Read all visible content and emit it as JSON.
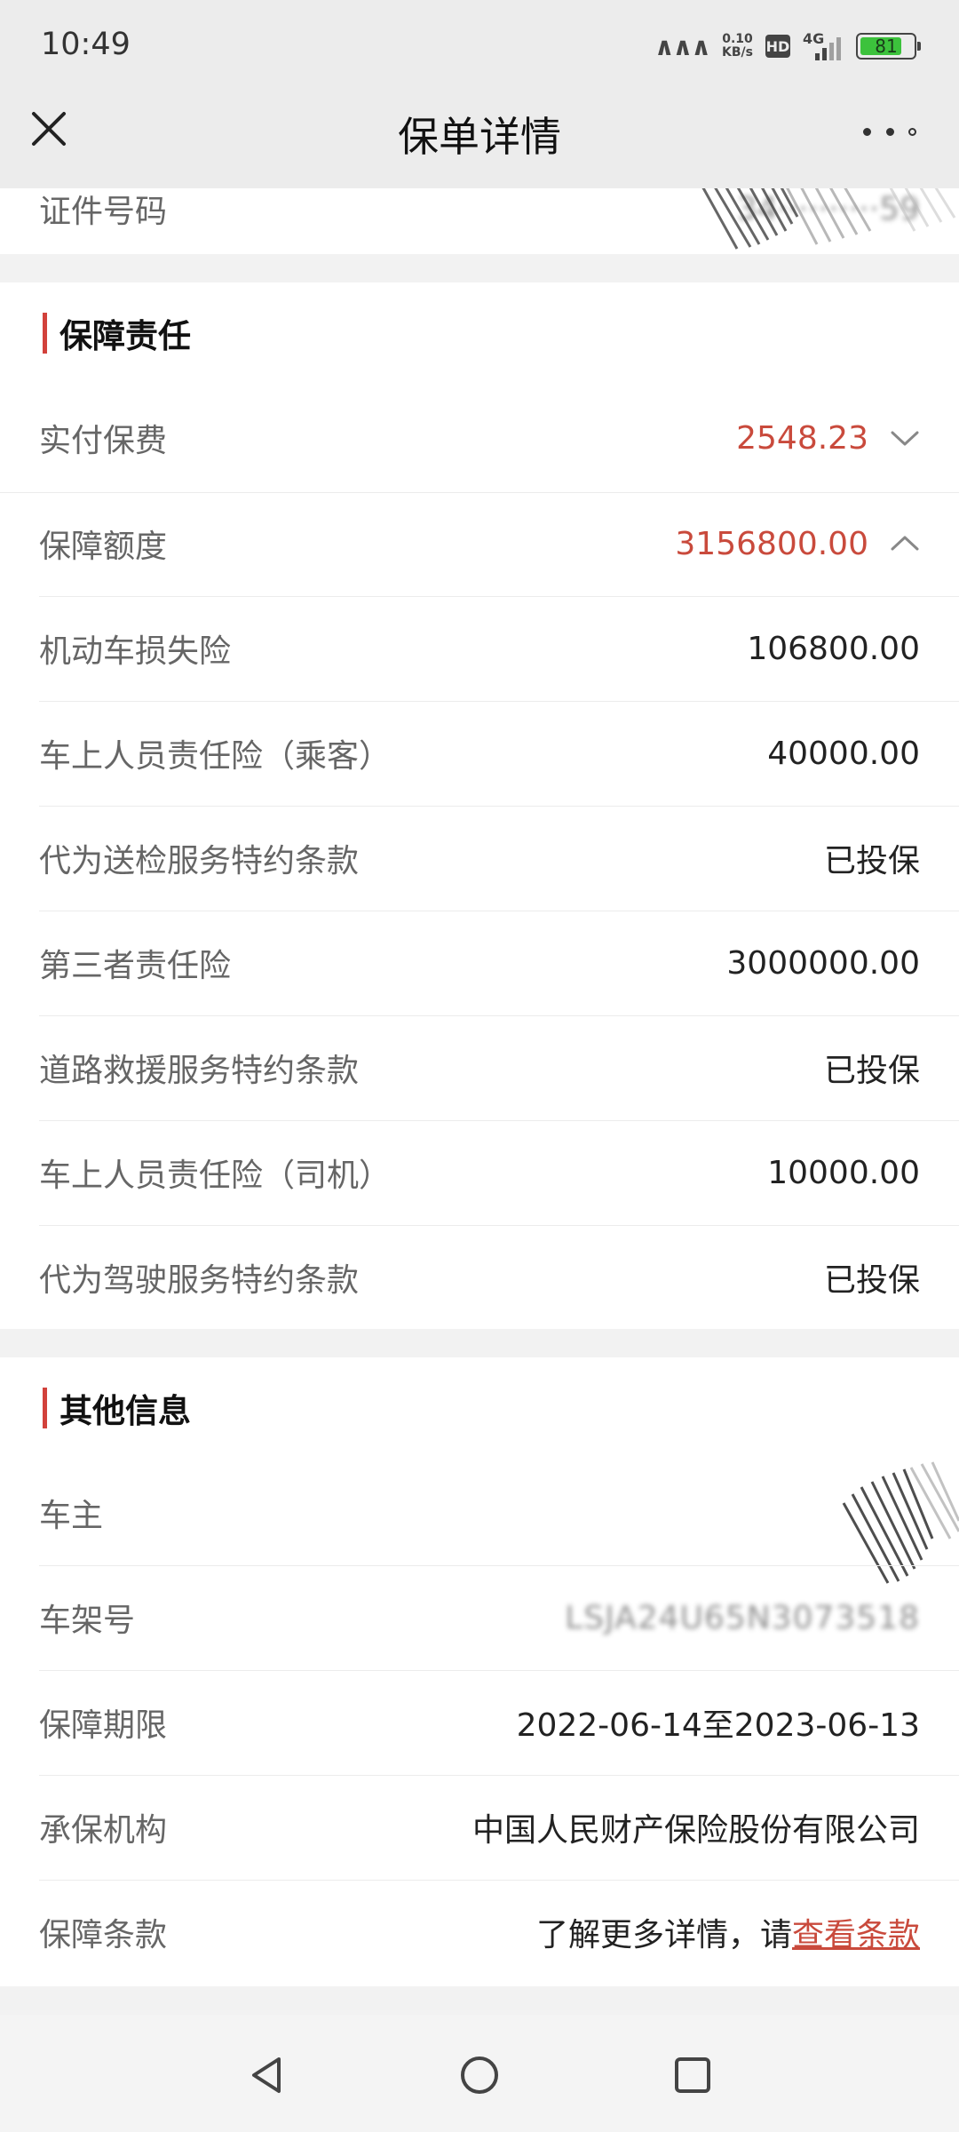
{
  "status_bar": {
    "time": "10:49",
    "net_speed_value": "0.10",
    "net_speed_unit": "KB/s",
    "hd_label": "HD",
    "network_type": "4G",
    "battery_level": "81",
    "battery_fill_fraction": 0.81
  },
  "header": {
    "title": "保单详情",
    "close_icon": "close-icon",
    "more_icon": "more-dots-icon"
  },
  "top_card": {
    "id_label": "证件号码",
    "id_value": "34··········59"
  },
  "coverage": {
    "title": "保障责任",
    "premium_label": "实付保费",
    "premium_value": "2548.23",
    "coverage_label": "保障额度",
    "coverage_value": "3156800.00",
    "items": [
      {
        "label": "机动车损失险",
        "value": "106800.00"
      },
      {
        "label": "车上人员责任险（乘客）",
        "value": "40000.00"
      },
      {
        "label": "代为送检服务特约条款",
        "value": "已投保"
      },
      {
        "label": "第三者责任险",
        "value": "3000000.00"
      },
      {
        "label": "道路救援服务特约条款",
        "value": "已投保"
      },
      {
        "label": "车上人员责任险（司机）",
        "value": "10000.00"
      },
      {
        "label": "代为驾驶服务特约条款",
        "value": "已投保"
      }
    ]
  },
  "other_info": {
    "title": "其他信息",
    "owner_label": "车主",
    "vin_label": "车架号",
    "vin_value": "LSJA24U65N3073518",
    "period_label": "保障期限",
    "period_value": "2022-06-14至2023-06-13",
    "insurer_label": "承保机构",
    "insurer_value": "中国人民财产保险股份有限公司",
    "terms_label": "保障条款",
    "terms_prefix": "了解更多详情，请",
    "terms_link": "查看条款"
  },
  "colors": {
    "accent_red": "#c94a3c",
    "section_bar": "#d2413b",
    "battery_green": "#3cc23c",
    "background": "#f2f2f2"
  },
  "nav_bar": {
    "back_icon": "back-triangle-icon",
    "home_icon": "home-circle-icon",
    "recents_icon": "recents-square-icon"
  }
}
